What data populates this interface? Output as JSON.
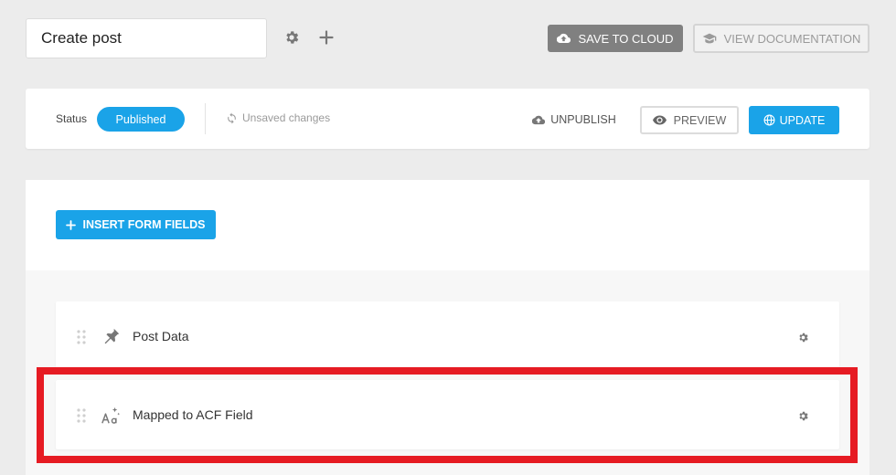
{
  "header": {
    "title_value": "Create post",
    "settings_icon": "gear-icon",
    "add_icon": "plus-icon",
    "save_label": "SAVE TO CLOUD",
    "docs_label": "VIEW DOCUMENTATION"
  },
  "status_bar": {
    "status_label": "Status",
    "status_value": "Published",
    "unsaved_text": "Unsaved changes",
    "unpublish_label": "UNPUBLISH",
    "preview_label": "PREVIEW",
    "update_label": "UPDATE"
  },
  "form": {
    "insert_label": "INSERT FORM FIELDS",
    "fields": [
      {
        "label": "Post Data",
        "icon": "pin-icon"
      },
      {
        "label": "Mapped to ACF Field",
        "icon": "text-format-icon"
      }
    ]
  },
  "colors": {
    "accent": "#1aa3e8",
    "save_button": "#808080",
    "highlight": "#e61b23"
  }
}
